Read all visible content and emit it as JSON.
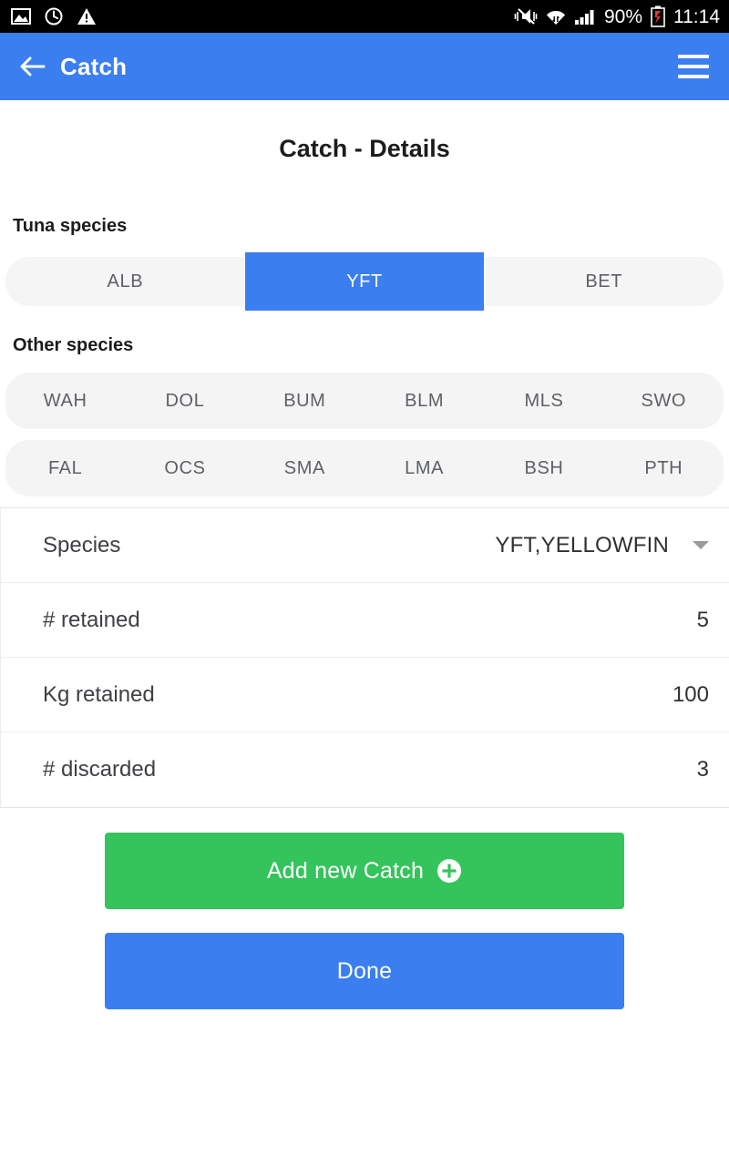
{
  "statusbar": {
    "icons_left": [
      "image-icon",
      "alarm-icon",
      "warning-icon"
    ],
    "icons_right": [
      "mute-vibrate-icon",
      "wifi-icon",
      "signal-icon",
      "battery-icon"
    ],
    "battery_percent": "90%",
    "time": "11:14"
  },
  "appbar": {
    "back_icon": "back-arrow-icon",
    "title": "Catch",
    "menu_icon": "hamburger-menu-icon"
  },
  "page": {
    "title": "Catch - Details",
    "tuna": {
      "label": "Tuna species",
      "options": [
        {
          "code": "ALB",
          "selected": false
        },
        {
          "code": "YFT",
          "selected": true
        },
        {
          "code": "BET",
          "selected": false
        }
      ]
    },
    "other": {
      "label": "Other species",
      "rows": [
        [
          "WAH",
          "DOL",
          "BUM",
          "BLM",
          "MLS",
          "SWO"
        ],
        [
          "FAL",
          "OCS",
          "SMA",
          "LMA",
          "BSH",
          "PTH"
        ]
      ]
    },
    "details": [
      {
        "label": "Species",
        "value": "YFT,YELLOWFIN",
        "has_caret": true
      },
      {
        "label": "# retained",
        "value": "5",
        "has_caret": false
      },
      {
        "label": "Kg retained",
        "value": "100",
        "has_caret": false
      },
      {
        "label": "# discarded",
        "value": "3",
        "has_caret": false
      }
    ],
    "buttons": {
      "add": {
        "label": "Add new Catch",
        "icon": "plus-circle-icon"
      },
      "done": {
        "label": "Done"
      }
    }
  },
  "colors": {
    "accent_blue": "#3b7ef0",
    "green": "#35c45c",
    "track_gray": "#f5f5f5",
    "status_black": "#000000"
  }
}
